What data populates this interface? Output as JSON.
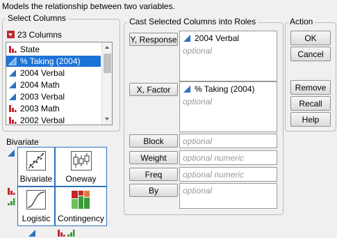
{
  "header": {
    "text": "Models the relationship between two variables."
  },
  "select_columns": {
    "title": "Select Columns",
    "count_label": "23 Columns",
    "items": [
      {
        "label": "State",
        "icon": "nominal-bar-icon",
        "selected": false
      },
      {
        "label": "% Taking (2004)",
        "icon": "continuous-triangle-icon",
        "selected": true
      },
      {
        "label": "2004 Verbal",
        "icon": "continuous-triangle-icon",
        "selected": false
      },
      {
        "label": "2004 Math",
        "icon": "continuous-triangle-icon",
        "selected": false
      },
      {
        "label": "2003 Verbal",
        "icon": "continuous-triangle-icon",
        "selected": false
      },
      {
        "label": "2003 Math",
        "icon": "continuous-triangle-icon",
        "selected": false
      },
      {
        "label": "2002 Verbal",
        "icon": "continuous-triangle-icon",
        "selected": false
      }
    ]
  },
  "roles": {
    "title": "Cast Selected Columns into Roles",
    "y": {
      "button": "Y, Response",
      "value": "2004 Verbal",
      "hint": "optional"
    },
    "x": {
      "button": "X, Factor",
      "value": "% Taking (2004)",
      "hint": "optional"
    },
    "block": {
      "button": "Block",
      "hint": "optional"
    },
    "weight": {
      "button": "Weight",
      "hint": "optional numeric"
    },
    "freq": {
      "button": "Freq",
      "hint": "optional numeric"
    },
    "by": {
      "button": "By",
      "hint": "optional"
    }
  },
  "action": {
    "title": "Action",
    "ok": "OK",
    "cancel": "Cancel",
    "remove": "Remove",
    "recall": "Recall",
    "help": "Help"
  },
  "bivariate": {
    "title": "Bivariate",
    "cells": {
      "bivariate": "Bivariate",
      "oneway": "Oneway",
      "logistic": "Logistic",
      "contingency": "Contingency"
    }
  },
  "colors": {
    "selection": "#1c73d6",
    "accent_blue": "#2f6fbf",
    "nominal_red": "#c1272d",
    "ordinal_green": "#3a9b3a"
  }
}
